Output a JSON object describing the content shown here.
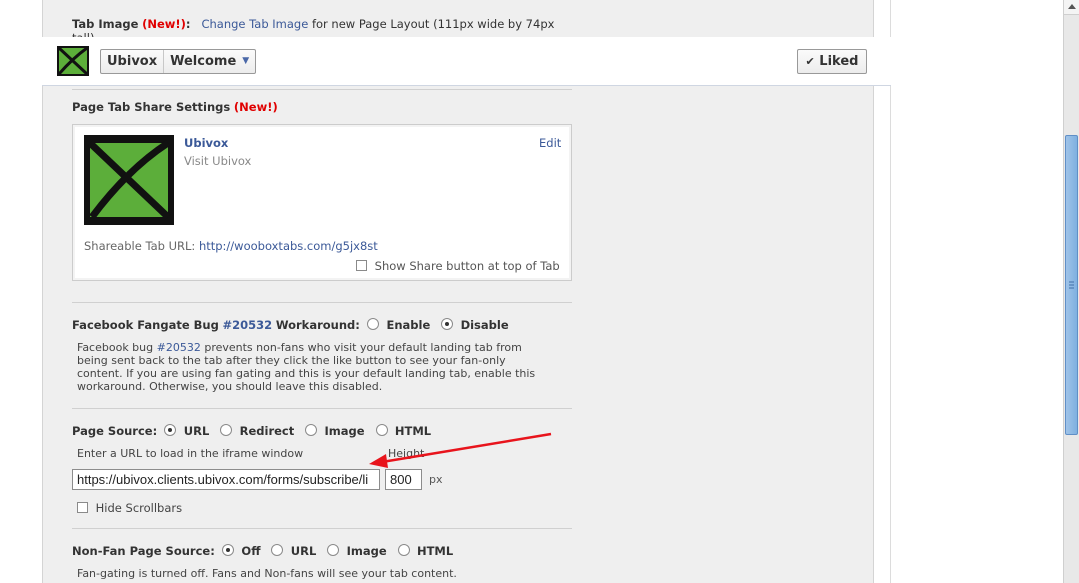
{
  "tab_image": {
    "label": "Tab Image",
    "new_badge": "(New!)",
    "colon": ":",
    "link": "Change Tab Image",
    "desc": "for new Page Layout (111px wide by 74px",
    "desc_cont": "tall)"
  },
  "header": {
    "page_name": "Ubivox",
    "tab_name": "Welcome",
    "liked_label": "Liked"
  },
  "share": {
    "title": "Page Tab Share Settings",
    "new_badge": "(New!)",
    "name": "Ubivox",
    "visit": "Visit Ubivox",
    "edit": "Edit",
    "url_label": "Shareable Tab URL:",
    "url": "http://wooboxtabs.com/g5jx8st",
    "show_share": "Show Share button at top of Tab"
  },
  "fangate_bug": {
    "label_pre": "Facebook Fangate Bug",
    "bug_id": "#20532",
    "label_post": "Workaround:",
    "enable": "Enable",
    "disable": "Disable",
    "line1_pre": "Facebook bug",
    "line1_id": "#20532",
    "line1_post": "prevents non-fans who visit your default landing tab from",
    "line2": "being sent back to the tab after they click the like button to see your fan-only",
    "line3": "content. If you are using fan gating and this is your default landing tab, enable this",
    "line4": "workaround. Otherwise, you should leave this disabled."
  },
  "page_source": {
    "label": "Page Source:",
    "options": [
      "URL",
      "Redirect",
      "Image",
      "HTML"
    ],
    "url_hint": "Enter a URL to load in the iframe window",
    "height_label": "Height",
    "url_value": "https://ubivox.clients.ubivox.com/forms/subscribe/li",
    "height_value": "800",
    "px": "px",
    "hide_scrollbars": "Hide Scrollbars"
  },
  "nonfan_source": {
    "label": "Non-Fan Page Source:",
    "options": [
      "Off",
      "URL",
      "Image",
      "HTML"
    ],
    "note": "Fan-gating is turned off. Fans and Non-fans will see your tab content."
  },
  "colors": {
    "link": "#3b5998",
    "new_badge": "#e00000",
    "arrow": "#e8141c",
    "logo_green": "#5cae3a"
  }
}
